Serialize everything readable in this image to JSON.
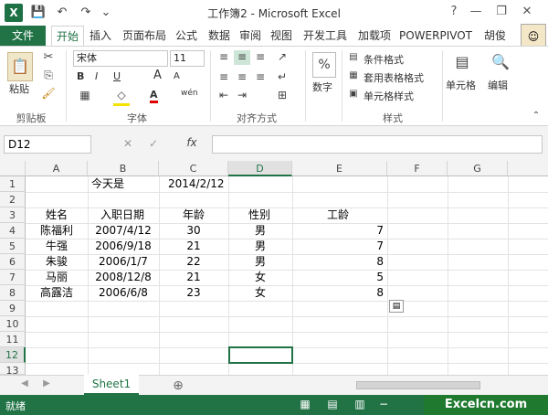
{
  "window": {
    "title": "工作簿2 - Microsoft Excel",
    "minimize": "—",
    "restore": "❐",
    "close": "✕",
    "help": "?"
  },
  "qat": {
    "save": "💾",
    "undo": "↶",
    "redo": "↷",
    "more": "⌄"
  },
  "tabs": [
    "文件",
    "开始",
    "插入",
    "页面布局",
    "公式",
    "数据",
    "审阅",
    "视图",
    "开发工具",
    "加载项",
    "POWERPIVOT",
    "胡俊"
  ],
  "ribbon": {
    "clipboard": {
      "paste": "粘贴",
      "label": "剪贴板"
    },
    "font": {
      "name": "宋体",
      "size": "11",
      "label": "字体",
      "bold": "B",
      "italic": "I",
      "underline": "U",
      "grow": "A",
      "shrink": "A",
      "wen": "wén"
    },
    "align": {
      "label": "对齐方式"
    },
    "number": {
      "btn": "数字",
      "symbol": "%"
    },
    "styles": {
      "cond": "条件格式",
      "table": "套用表格格式",
      "cell": "单元格样式",
      "label": "样式"
    },
    "cells": {
      "btn": "单元格"
    },
    "edit": {
      "btn": "编辑"
    }
  },
  "formula_bar": {
    "name_box": "D12",
    "fx": "fx",
    "cancel": "✕",
    "enter": "✓",
    "value": ""
  },
  "columns": [
    "A",
    "B",
    "C",
    "D",
    "E",
    "F",
    "G"
  ],
  "rows": [
    "1",
    "2",
    "3",
    "4",
    "5",
    "6",
    "7",
    "8",
    "9",
    "10",
    "11",
    "12",
    "13"
  ],
  "sheet": {
    "b1": "今天是",
    "c1": "2014/2/12",
    "headers": [
      "姓名",
      "入职日期",
      "年龄",
      "性别",
      "工龄"
    ],
    "records": [
      [
        "陈福利",
        "2007/4/12",
        "30",
        "男",
        "7"
      ],
      [
        "牛强",
        "2006/9/18",
        "21",
        "男",
        "7"
      ],
      [
        "朱骏",
        "2006/1/7",
        "22",
        "男",
        "8"
      ],
      [
        "马丽",
        "2008/12/8",
        "21",
        "女",
        "5"
      ],
      [
        "高露洁",
        "2006/6/8",
        "23",
        "女",
        "8"
      ]
    ]
  },
  "sheet_tabs": {
    "active": "Sheet1",
    "add": "⊕"
  },
  "status": {
    "ready": "就绪"
  },
  "watermark": "Excelcn.com"
}
